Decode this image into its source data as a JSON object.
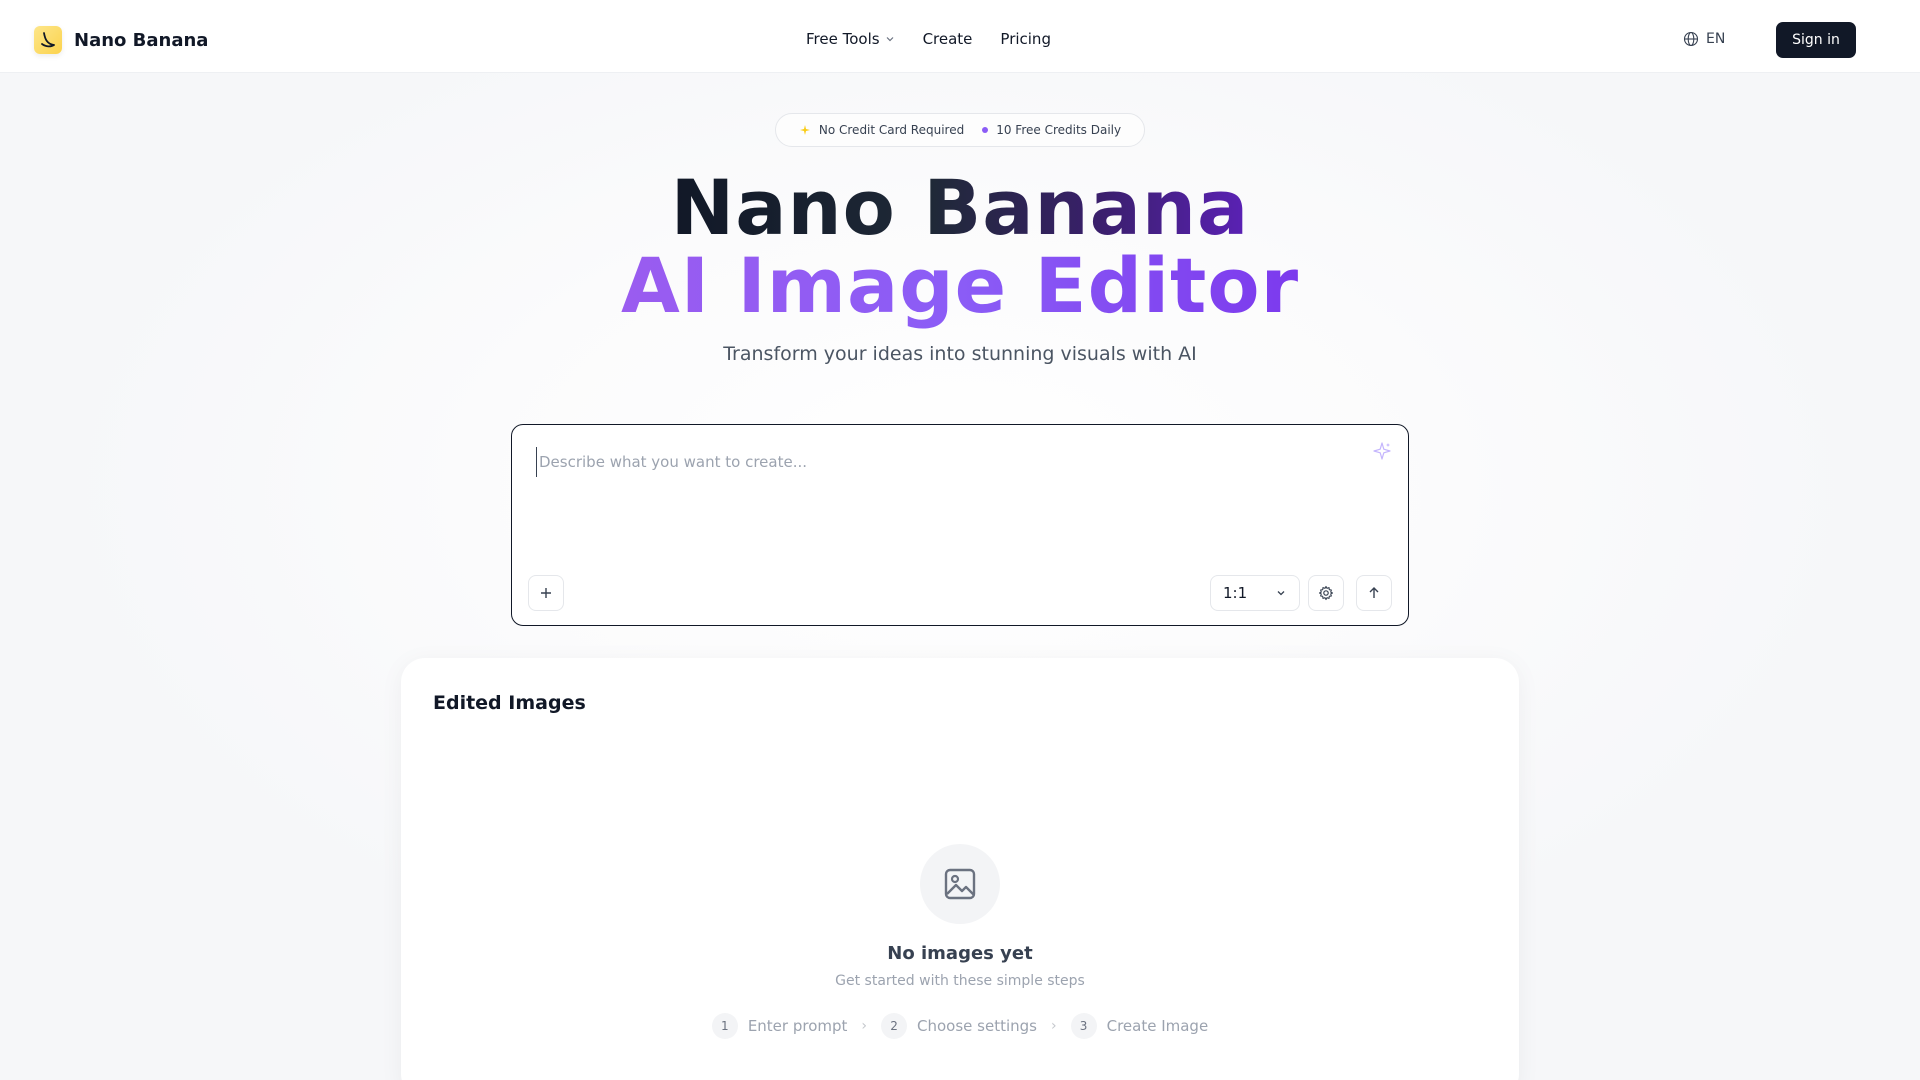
{
  "brand": {
    "name": "Nano Banana",
    "icon": "banana-icon"
  },
  "nav": {
    "items": [
      {
        "label": "Free Tools",
        "has_dropdown": true
      },
      {
        "label": "Create"
      },
      {
        "label": "Pricing"
      }
    ]
  },
  "header": {
    "language": "EN",
    "signin_label": "Sign in"
  },
  "hero": {
    "badge": {
      "left": "No Credit Card Required",
      "right": "10 Free Credits Daily"
    },
    "title_line1": "Nano Banana",
    "title_line2": "AI Image Editor",
    "subtitle": "Transform your ideas into stunning visuals with AI"
  },
  "prompt": {
    "placeholder": "Describe what you want to create...",
    "value": "",
    "aspect_ratio": "1:1"
  },
  "gallery": {
    "title": "Edited Images",
    "empty_title": "No images yet",
    "empty_subtitle": "Get started with these simple steps",
    "steps": [
      {
        "num": "1",
        "label": "Enter prompt"
      },
      {
        "num": "2",
        "label": "Choose settings"
      },
      {
        "num": "3",
        "label": "Create Image"
      }
    ]
  },
  "colors": {
    "accent": "#8b5cf6",
    "dark": "#111827",
    "brand_yellow": "#fcd34d"
  }
}
